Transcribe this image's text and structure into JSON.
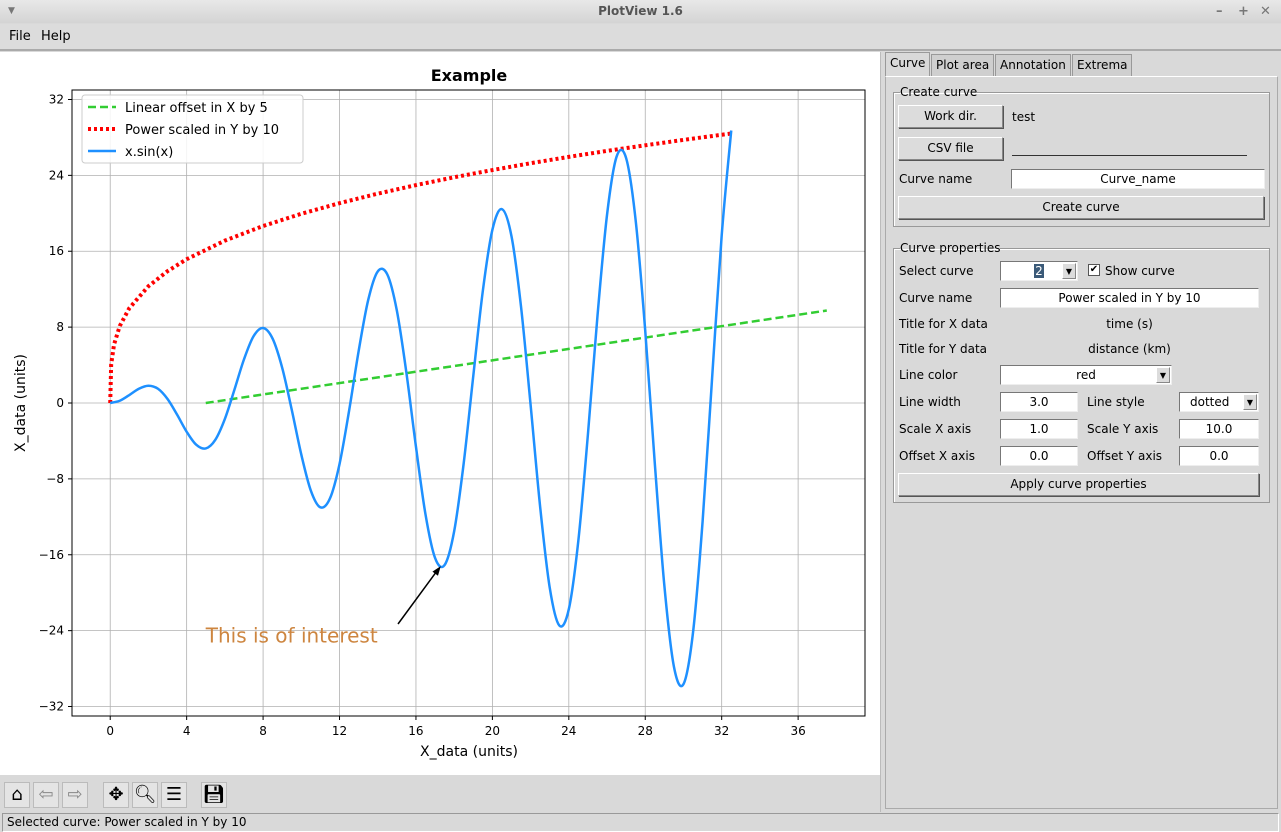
{
  "window": {
    "title": "PlotView 1.6"
  },
  "menu": {
    "file": "File",
    "help": "Help"
  },
  "status": "Selected curve: Power scaled in Y by 10",
  "toolbar": {
    "icons": [
      "home-icon",
      "back-arrow-icon",
      "forward-arrow-icon",
      "pan-icon",
      "zoom-icon",
      "configure-subplots-icon",
      "save-icon"
    ]
  },
  "tabs": [
    "Curve",
    "Plot area",
    "Annotation",
    "Extrema"
  ],
  "create_curve": {
    "legend": "Create curve",
    "work_dir_button": "Work dir.",
    "work_dir_value": "test",
    "csv_button": "CSV file",
    "csv_value": "",
    "curve_name_label": "Curve name",
    "curve_name_value": "Curve_name",
    "create_button": "Create curve"
  },
  "curve_properties": {
    "legend": "Curve properties",
    "select_curve_label": "Select curve",
    "select_curve_value": "2",
    "show_curve_label": "Show curve",
    "show_curve_checked": true,
    "curve_name_label": "Curve name",
    "curve_name_value": "Power scaled in Y by 10",
    "title_x_label": "Title for X data",
    "title_x_value": "time (s)",
    "title_y_label": "Title for Y data",
    "title_y_value": "distance (km)",
    "line_color_label": "Line color",
    "line_color_value": "red",
    "line_width_label": "Line width",
    "line_width_value": "3.0",
    "line_style_label": "Line style",
    "line_style_value": "dotted",
    "scale_x_label": "Scale X axis",
    "scale_x_value": "1.0",
    "scale_y_label": "Scale Y axis",
    "scale_y_value": "10.0",
    "offset_x_label": "Offset X axis",
    "offset_x_value": "0.0",
    "offset_y_label": "Offset Y axis",
    "offset_y_value": "0.0",
    "apply_button": "Apply curve properties"
  },
  "chart_data": {
    "type": "line",
    "title": "Example",
    "xlabel": "X_data (units)",
    "ylabel": "X_data (units)",
    "xlim": [
      -2,
      39.5
    ],
    "ylim": [
      -33,
      33
    ],
    "grid": true,
    "legend_position": "top-left",
    "xticks": [
      "0",
      "4",
      "8",
      "12",
      "16",
      "20",
      "24",
      "28",
      "32",
      "36"
    ],
    "yticks": [
      "32",
      "24",
      "16",
      "8",
      "0",
      "−8",
      "−16",
      "−24",
      "−32"
    ],
    "series": [
      {
        "name": "Linear offset in X by 5",
        "color": "#32cd32",
        "style": "dashed",
        "x": [
          5,
          37.5
        ],
        "y": [
          0,
          9.75
        ]
      },
      {
        "name": "Power scaled in Y by 10",
        "color": "#ff0000",
        "style": "dotted",
        "x": [
          0,
          0.05,
          0.2,
          0.5,
          1,
          2,
          3,
          4,
          6,
          8,
          10,
          12,
          14,
          16,
          18,
          20,
          22,
          24,
          26,
          28,
          30,
          32,
          32.5
        ],
        "y": [
          0,
          4.07,
          6.17,
          8.12,
          10,
          12.31,
          13.9,
          15.16,
          17.12,
          18.66,
          19.95,
          21.07,
          22.07,
          22.97,
          23.8,
          24.56,
          25.28,
          25.95,
          26.58,
          27.17,
          27.74,
          28.28,
          28.41
        ]
      },
      {
        "name": "x.sin(x)",
        "color": "#1e90ff",
        "style": "solid",
        "x": [
          0,
          0.5,
          1,
          1.5,
          2,
          2.5,
          3,
          3.5,
          4,
          4.5,
          5,
          5.5,
          6,
          6.5,
          7,
          7.5,
          8,
          8.5,
          9,
          9.5,
          10,
          10.5,
          11,
          11.5,
          12,
          12.5,
          13,
          13.5,
          14,
          14.5,
          15,
          15.5,
          16,
          16.5,
          17,
          17.5,
          18,
          18.5,
          19,
          19.5,
          20,
          20.5,
          21,
          21.5,
          22,
          22.5,
          23,
          23.5,
          24,
          24.5,
          25,
          25.5,
          26,
          26.5,
          27,
          27.5,
          28,
          28.5,
          29,
          29.5,
          30,
          30.5,
          31,
          31.5,
          32,
          32.5
        ],
        "y": [
          0,
          0.24,
          0.84,
          1.5,
          1.82,
          1.5,
          0.42,
          -1.23,
          -3.03,
          -4.4,
          -4.79,
          -3.88,
          -1.68,
          1.4,
          4.6,
          7.04,
          7.91,
          6.78,
          3.71,
          -0.71,
          -5.44,
          -9.24,
          -11,
          -10.06,
          -6.44,
          -0.83,
          5.46,
          10.85,
          13.87,
          13.56,
          9.75,
          3.19,
          -4.61,
          -11.75,
          -16.34,
          -17.08,
          -13.52,
          -6.33,
          2.85,
          11.82,
          18.26,
          20.44,
          17.58,
          10.13,
          -0.2,
          -10.96,
          -19.46,
          -23.45,
          -21.74,
          -14.48,
          -3.3,
          9.18,
          19.84,
          25.97,
          25.81,
          19.22,
          7.59,
          -6.38,
          -19.26,
          -27.79,
          -29.64,
          -24.19,
          -12.52,
          2.68,
          17.66,
          28.73
        ]
      }
    ],
    "annotation": {
      "text": "This is of interest",
      "color": "#cd853f",
      "xy": [
        17.3,
        -17.2
      ],
      "xytext": [
        5,
        -24.5
      ]
    }
  }
}
